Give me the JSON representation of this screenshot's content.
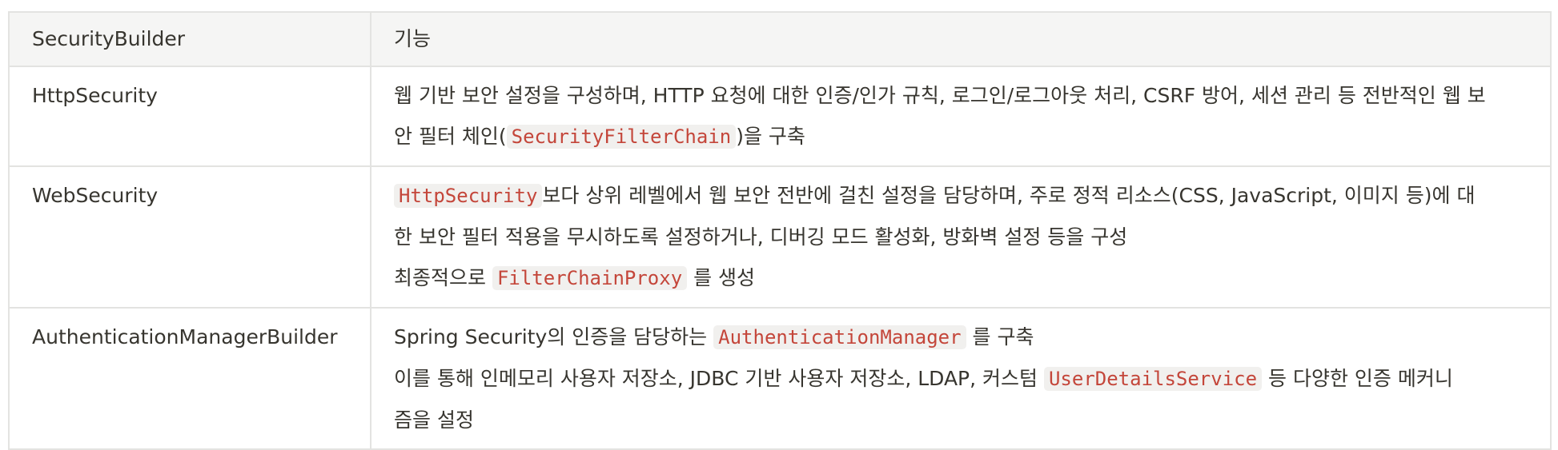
{
  "table": {
    "headers": [
      "SecurityBuilder",
      "기능"
    ],
    "rows": [
      {
        "name": "HttpSecurity",
        "lines": [
          [
            {
              "t": "웹 기반 보안 설정을 구성하며, HTTP 요청에 대한 인증/인가 규칙, 로그인/로그아웃 처리, CSRF 방어, 세션 관리 등 전반적인 웹 보"
            }
          ],
          [
            {
              "t": "안 필터 체인("
            },
            {
              "c": "SecurityFilterChain"
            },
            {
              "t": ")을 구축"
            }
          ]
        ]
      },
      {
        "name": "WebSecurity",
        "lines": [
          [
            {
              "c": "HttpSecurity"
            },
            {
              "t": "보다 상위 레벨에서 웹 보안 전반에 걸친 설정을 담당하며, 주로 정적 리소스(CSS, JavaScript, 이미지 등)에 대"
            }
          ],
          [
            {
              "t": "한 보안 필터 적용을 무시하도록 설정하거나, 디버깅 모드 활성화, 방화벽 설정 등을 구성"
            }
          ],
          [
            {
              "t": "최종적으로 "
            },
            {
              "c": "FilterChainProxy"
            },
            {
              "t": " 를 생성"
            }
          ]
        ]
      },
      {
        "name": "AuthenticationManagerBuilder",
        "lines": [
          [
            {
              "t": "Spring Security의 인증을 담당하는 "
            },
            {
              "c": "AuthenticationManager"
            },
            {
              "t": " 를 구축"
            }
          ],
          [
            {
              "t": "이를 통해 인메모리 사용자 저장소, JDBC 기반 사용자 저장소, LDAP, 커스텀 "
            },
            {
              "c": "UserDetailsService"
            },
            {
              "t": " 등 다양한 인증 메커니"
            }
          ],
          [
            {
              "t": "즘을 설정"
            }
          ]
        ]
      }
    ]
  }
}
